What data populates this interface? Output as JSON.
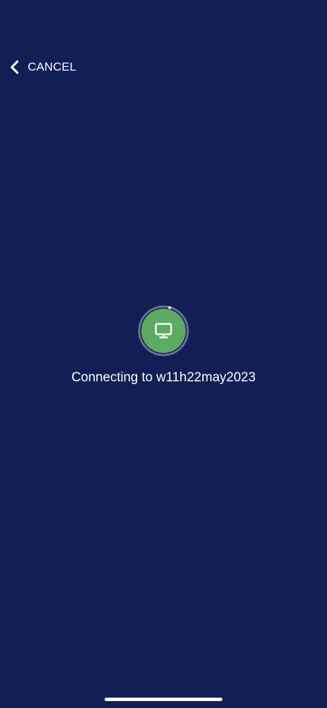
{
  "header": {
    "cancel_label": "CANCEL",
    "back_icon": "chevron-left-icon"
  },
  "status": {
    "icon": "desktop-computer-icon",
    "message": "Connecting to w11h22may2023"
  },
  "colors": {
    "background": "#121f56",
    "accent_green": "#5dab63",
    "ring": "#6d7293",
    "text": "#ffffff"
  }
}
